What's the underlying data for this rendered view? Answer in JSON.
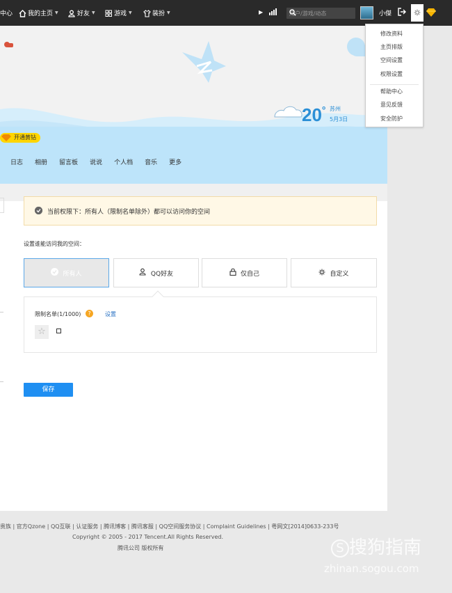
{
  "topbar": {
    "left_cut": "中心",
    "home": "我的主页",
    "friends": "好友",
    "games": "游戏",
    "dress": "装扮",
    "search_placeholder": "用户/游戏/动态",
    "username": "小傑"
  },
  "dropdown": {
    "group1": [
      "修改资料",
      "主页排版",
      "空间设置",
      "权限设置"
    ],
    "group2": [
      "帮助中心",
      "意见反馈",
      "安全防护"
    ]
  },
  "banner": {
    "yellow_button": "开通黄钻",
    "weather": {
      "temp": "20",
      "unit": "°",
      "city": "苏州",
      "date": "5月3日"
    }
  },
  "nav": [
    "日志",
    "相册",
    "留言板",
    "说说",
    "个人档",
    "音乐",
    "更多"
  ],
  "permission": {
    "notice": "当前权限下：所有人（限制名单除外）都可以访问你的空间",
    "question": "设置谁能访问我的空间：",
    "options": [
      "所有人",
      "QQ好友",
      "仅自己",
      "自定义"
    ],
    "restrict_label": "限制名单(1/1000)",
    "restrict_help": "?",
    "restrict_set": "设置",
    "save": "保存"
  },
  "footer": {
    "line1": "贵族 | 官方Qzone | QQ互联 | 认证服务 | 腾讯博客 | 腾讯客服 | QQ空间服务协议 | Complaint Guidelines | 粤网文[2014]0633-233号",
    "line2": "Copyright © 2005 - 2017 Tencent.All Rights Reserved.",
    "line3": "腾讯公司 版权所有"
  },
  "watermark": {
    "brand": "搜狗指南",
    "url": "zhinan.sogou.com"
  }
}
